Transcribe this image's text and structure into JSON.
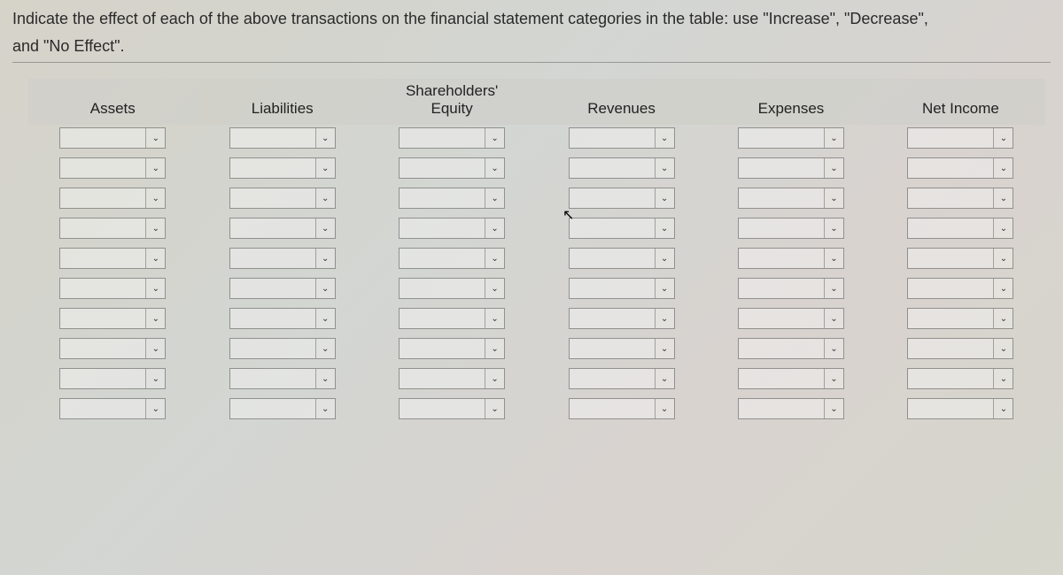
{
  "instruction_line1": "Indicate the effect of each of the above transactions on the financial statement categories in the table: use \"Increase\", \"Decrease\",",
  "instruction_line2": "and \"No Effect\".",
  "columns": [
    "Assets",
    "Liabilities",
    "Shareholders' Equity",
    "Revenues",
    "Expenses",
    "Net Income"
  ],
  "row_count": 10,
  "dropdown_icon": "⌄",
  "cells": {
    "values_all_empty": true
  }
}
